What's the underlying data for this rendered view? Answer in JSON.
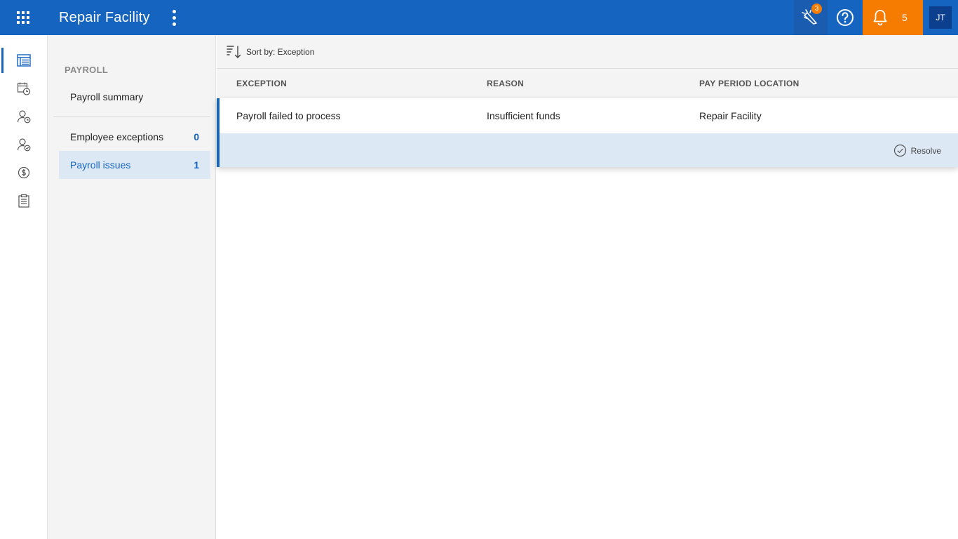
{
  "header": {
    "title": "Repair Facility",
    "celebrate_badge": "3",
    "notifications_count": "5",
    "user_initials": "JT",
    "brand_color": "#1565c0",
    "alert_color": "#f57c00"
  },
  "rail": {
    "items": [
      {
        "icon": "table-list-icon",
        "active": true
      },
      {
        "icon": "calendar-clock-icon",
        "active": false
      },
      {
        "icon": "person-clock-icon",
        "active": false
      },
      {
        "icon": "person-check-icon",
        "active": false
      },
      {
        "icon": "dollar-circle-icon",
        "active": false
      },
      {
        "icon": "clipboard-icon",
        "active": false
      }
    ]
  },
  "subnav": {
    "heading": "PAYROLL",
    "summary_label": "Payroll summary",
    "employee_exceptions": {
      "label": "Employee exceptions",
      "count": "0"
    },
    "payroll_issues": {
      "label": "Payroll issues",
      "count": "1"
    }
  },
  "main": {
    "sort_label": "Sort by: Exception",
    "columns": {
      "exception": "EXCEPTION",
      "reason": "REASON",
      "location": "PAY PERIOD LOCATION"
    },
    "rows": [
      {
        "exception": "Payroll failed to process",
        "reason": "Insufficient funds",
        "location": "Repair Facility"
      }
    ],
    "resolve_label": "Resolve"
  }
}
